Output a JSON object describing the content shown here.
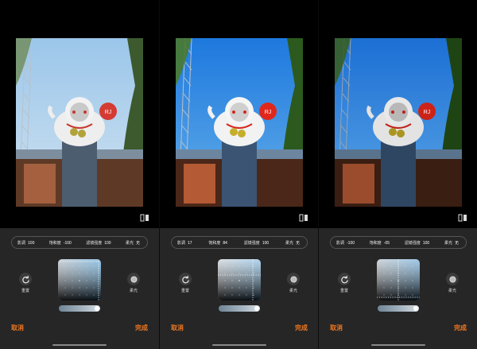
{
  "colors": {
    "accent": "#f07820",
    "editor_bg": "#262626",
    "page_bg": "#000000"
  },
  "icons": {
    "compare": "compare-split-icon",
    "reset": "reset-rotate-icon",
    "soft_light": "soft-light-circle-icon"
  },
  "panels": [
    {
      "params": [
        {
          "label": "影调",
          "value": "100"
        },
        {
          "label": "饱和度",
          "value": "-100"
        },
        {
          "label": "滤镜强度",
          "value": "100"
        },
        {
          "label": "柔光",
          "value": "无"
        }
      ],
      "reset_label": "重置",
      "soft_label": "柔光",
      "cancel_label": "取消",
      "done_label": "完成",
      "slider_level": 0.95,
      "sky": "pale",
      "crosshair": "top-right"
    },
    {
      "params": [
        {
          "label": "影调",
          "value": "17"
        },
        {
          "label": "饱和度",
          "value": "84"
        },
        {
          "label": "滤镜强度",
          "value": "100"
        },
        {
          "label": "柔光",
          "value": "无"
        }
      ],
      "reset_label": "重置",
      "soft_label": "柔光",
      "cancel_label": "取消",
      "done_label": "完成",
      "slider_level": 0.95,
      "sky": "vivid",
      "crosshair": "mid-right"
    },
    {
      "params": [
        {
          "label": "影调",
          "value": "-100"
        },
        {
          "label": "饱和度",
          "value": "-05"
        },
        {
          "label": "滤镜强度",
          "value": "100"
        },
        {
          "label": "柔光",
          "value": "无"
        }
      ],
      "reset_label": "重置",
      "soft_label": "柔光",
      "cancel_label": "取消",
      "done_label": "完成",
      "slider_level": 0.95,
      "sky": "vivid",
      "crosshair": "bottom-left"
    }
  ]
}
